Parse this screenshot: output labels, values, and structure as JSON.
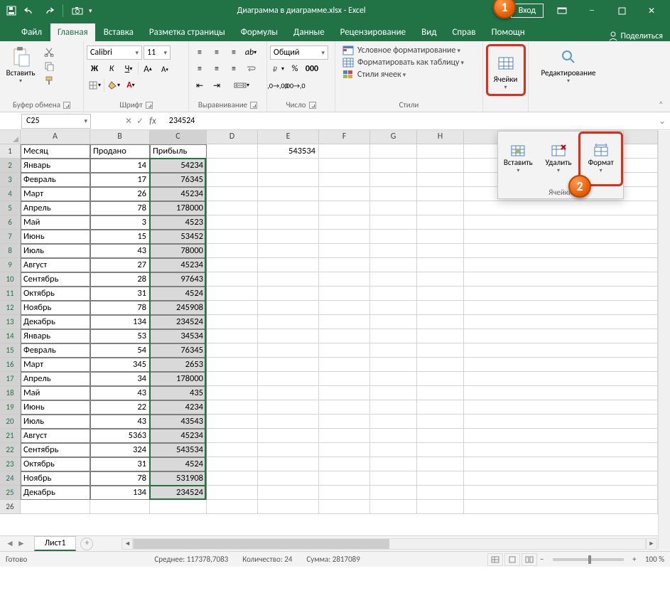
{
  "title": "Диаграмма в диаграмме.xlsx - Excel",
  "loginBtn": "Вход",
  "tabs": [
    "Файл",
    "Главная",
    "Вставка",
    "Разметка страницы",
    "Формулы",
    "Данные",
    "Рецензирование",
    "Вид",
    "Справ",
    "Помощн"
  ],
  "activeTab": 1,
  "share": "Поделиться",
  "ribbon": {
    "clipboard": {
      "paste": "Вставить",
      "label": "Буфер обмена"
    },
    "font": {
      "name": "Calibri",
      "size": "11",
      "label": "Шрифт"
    },
    "alignment": {
      "label": "Выравнивание"
    },
    "number": {
      "format": "Общий",
      "label": "Число"
    },
    "styles": {
      "cond": "Условное форматирование",
      "table": "Форматировать как таблицу",
      "cell": "Стили ячеек",
      "label": "Стили"
    },
    "cells": {
      "label": "Ячейки"
    },
    "editing": {
      "label": "Редактирование"
    }
  },
  "popup": {
    "insert": "Вставить",
    "delete": "Удалить",
    "format": "Формат",
    "label": "Ячейки"
  },
  "callouts": {
    "c1": "1",
    "c2": "2"
  },
  "namebox": "C25",
  "formula": "234524",
  "colHeaders": [
    "A",
    "B",
    "C",
    "D",
    "E",
    "F",
    "G",
    "H"
  ],
  "headers": [
    "Месяц",
    "Продано",
    "Прибыль"
  ],
  "strayE1": "543534",
  "rows": [
    [
      "Январь",
      "14",
      "54234"
    ],
    [
      "Февраль",
      "17",
      "76345"
    ],
    [
      "Март",
      "26",
      "45234"
    ],
    [
      "Апрель",
      "78",
      "178000"
    ],
    [
      "Май",
      "3",
      "4523"
    ],
    [
      "Июнь",
      "15",
      "53452"
    ],
    [
      "Июль",
      "43",
      "78000"
    ],
    [
      "Август",
      "27",
      "45234"
    ],
    [
      "Сентябрь",
      "28",
      "97643"
    ],
    [
      "Октябрь",
      "31",
      "4524"
    ],
    [
      "Ноябрь",
      "78",
      "245908"
    ],
    [
      "Декабрь",
      "134",
      "234524"
    ],
    [
      "Январь",
      "53",
      "34534"
    ],
    [
      "Февраль",
      "54",
      "76345"
    ],
    [
      "Март",
      "345",
      "2653"
    ],
    [
      "Апрель",
      "34",
      "178000"
    ],
    [
      "Май",
      "43",
      "435"
    ],
    [
      "Июнь",
      "22",
      "4234"
    ],
    [
      "Июль",
      "43",
      "43543"
    ],
    [
      "Август",
      "5363",
      "45234"
    ],
    [
      "Сентябрь",
      "324",
      "543534"
    ],
    [
      "Октябрь",
      "31",
      "4524"
    ],
    [
      "Ноябрь",
      "78",
      "531908"
    ],
    [
      "Декабрь",
      "134",
      "234524"
    ]
  ],
  "sheetTab": "Лист1",
  "status": {
    "ready": "Готово",
    "avg": "Среднее: 117378,7083",
    "count": "Количество: 24",
    "sum": "Сумма: 2817089",
    "zoom": "100 %"
  }
}
